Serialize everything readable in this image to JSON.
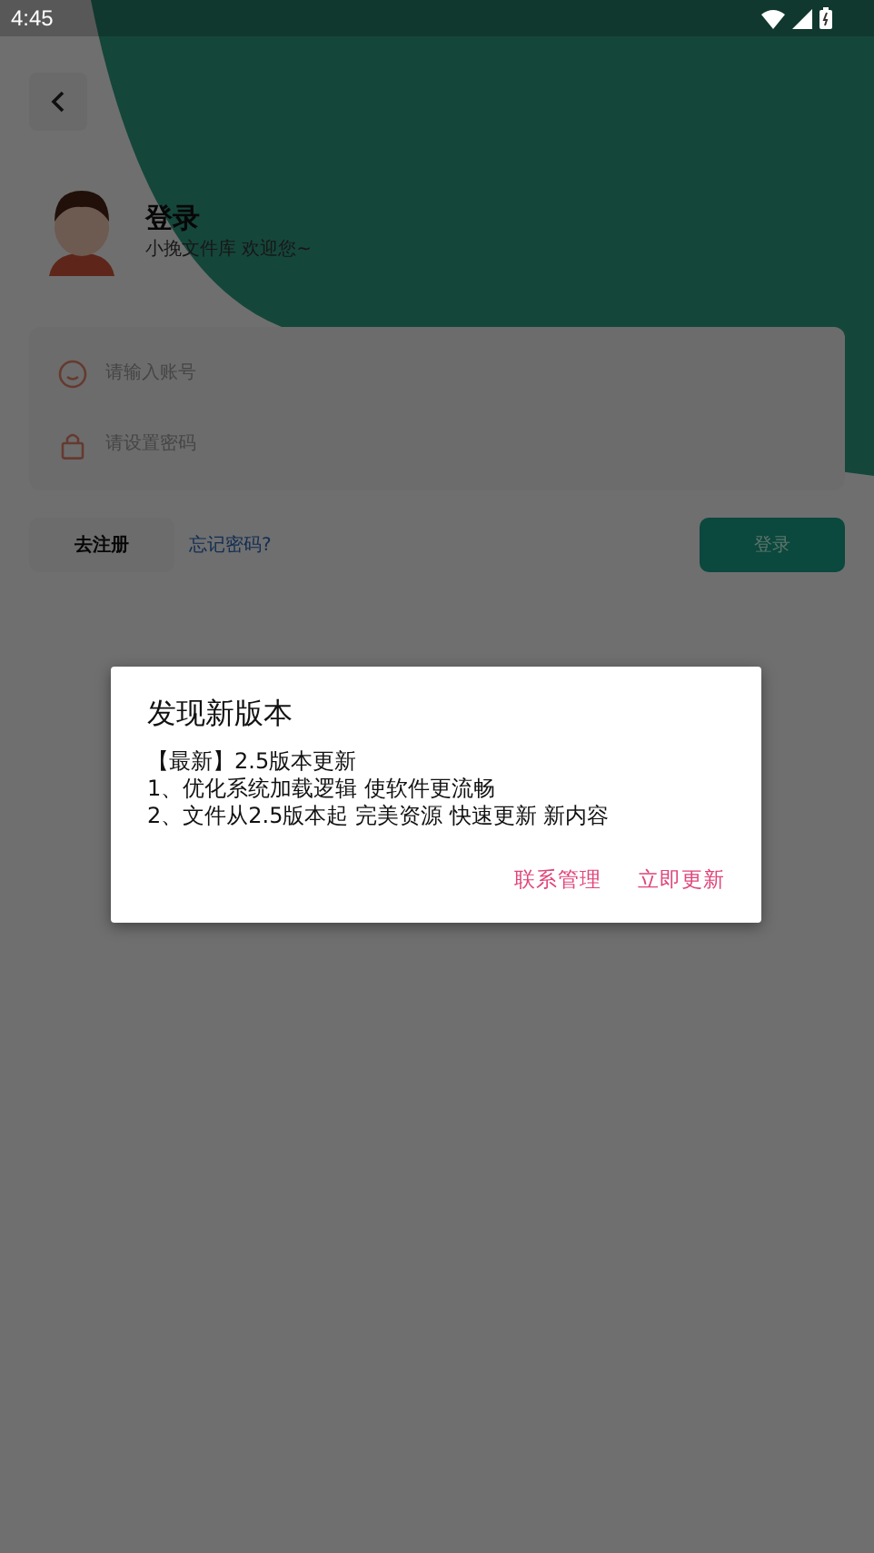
{
  "status_bar": {
    "time": "4:45"
  },
  "header": {
    "title": "登录",
    "subtitle": "小挽文件库 欢迎您~"
  },
  "form": {
    "fields": [
      {
        "kind": "account",
        "placeholder": "请输入账号"
      },
      {
        "kind": "password",
        "placeholder": "请设置密码"
      }
    ]
  },
  "actions": {
    "register": "去注册",
    "forgot": "忘记密码?",
    "login": "登录"
  },
  "dialog": {
    "title": "发现新版本",
    "lines": [
      "【最新】2.5版本更新",
      "1、优化系统加载逻辑 使软件更流畅",
      "2、文件从2.5版本起 完美资源 快速更新 新内容"
    ],
    "buttons": [
      "联系管理",
      "立即更新"
    ]
  }
}
